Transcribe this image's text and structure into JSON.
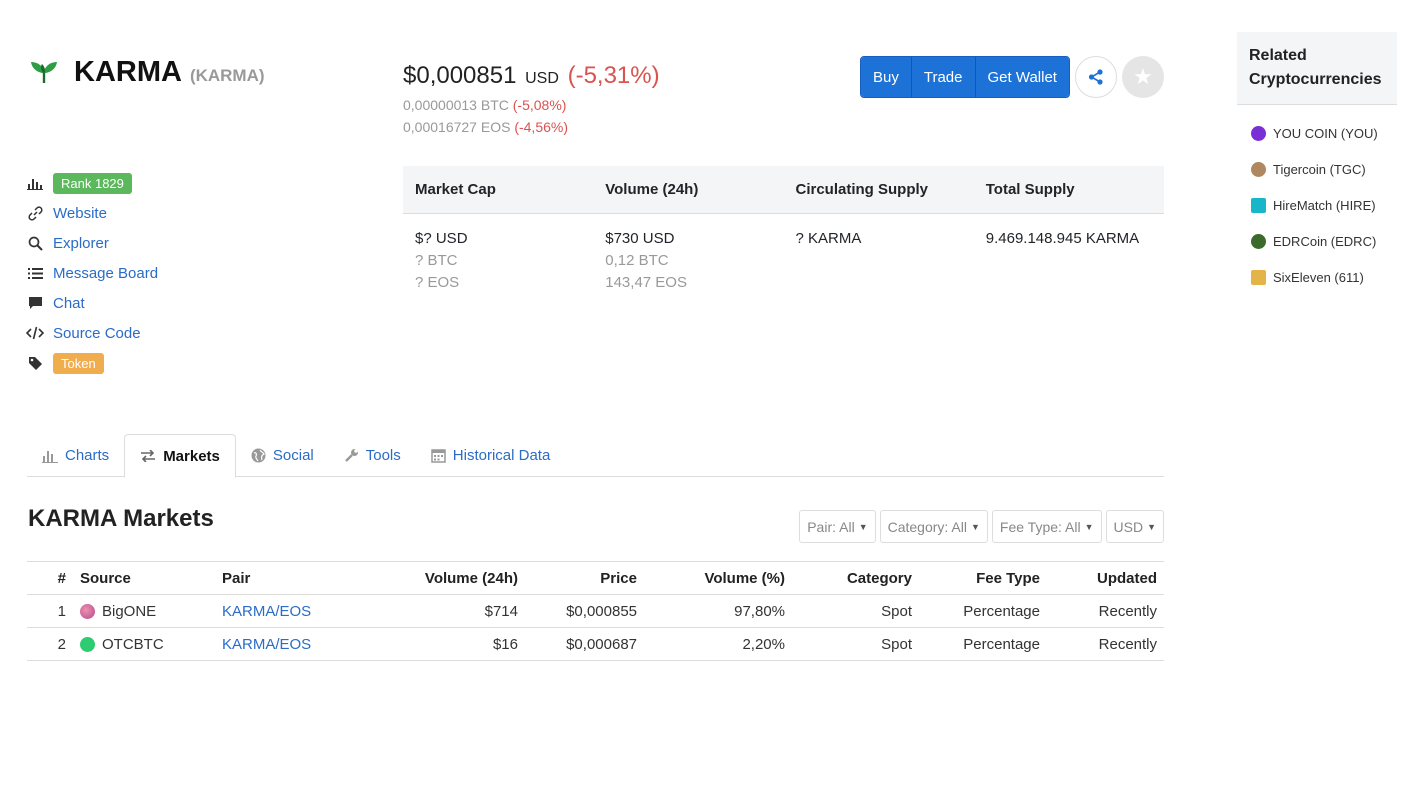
{
  "coin": {
    "name": "KARMA",
    "symbol": "(KARMA)"
  },
  "price": {
    "main": "$0,000851",
    "currency": "USD",
    "change": "(-5,31%)",
    "btc": "0,00000013 BTC",
    "btc_change": "(-5,08%)",
    "eos": "0,00016727 EOS",
    "eos_change": "(-4,56%)"
  },
  "actions": {
    "buy": "Buy",
    "trade": "Trade",
    "wallet": "Get Wallet"
  },
  "links": {
    "rank": "Rank 1829",
    "website": "Website",
    "explorer": "Explorer",
    "message_board": "Message Board",
    "chat": "Chat",
    "source_code": "Source Code",
    "token": "Token"
  },
  "stats": {
    "headers": [
      "Market Cap",
      "Volume (24h)",
      "Circulating Supply",
      "Total Supply"
    ],
    "market_cap": [
      "$? USD",
      "? BTC",
      "? EOS"
    ],
    "volume": [
      "$730 USD",
      "0,12 BTC",
      "143,47 EOS"
    ],
    "circulating": "? KARMA",
    "total": "9.469.148.945 KARMA"
  },
  "tabs": [
    "Charts",
    "Markets",
    "Social",
    "Tools",
    "Historical Data"
  ],
  "markets": {
    "title": "KARMA Markets",
    "filters": [
      "Pair: All",
      "Category: All",
      "Fee Type: All",
      "USD"
    ],
    "columns": [
      "#",
      "Source",
      "Pair",
      "Volume (24h)",
      "Price",
      "Volume (%)",
      "Category",
      "Fee Type",
      "Updated"
    ],
    "rows": [
      {
        "rank": "1",
        "source": "BigONE",
        "pair": "KARMA/EOS",
        "volume": "$714",
        "price": "$0,000855",
        "volume_pct": "97,80%",
        "category": "Spot",
        "fee_type": "Percentage",
        "updated": "Recently"
      },
      {
        "rank": "2",
        "source": "OTCBTC",
        "pair": "KARMA/EOS",
        "volume": "$16",
        "price": "$0,000687",
        "volume_pct": "2,20%",
        "category": "Spot",
        "fee_type": "Percentage",
        "updated": "Recently"
      }
    ]
  },
  "related": {
    "title": "Related Cryptocurrencies",
    "items": [
      "YOU COIN (YOU)",
      "Tigercoin (TGC)",
      "HireMatch (HIRE)",
      "EDRCoin (EDRC)",
      "SixEleven (611)"
    ]
  },
  "colors": {
    "accent": "#1d72d8",
    "negative": "#d9534f",
    "rank_badge": "#5cb85c",
    "token_badge": "#f0ad4e"
  }
}
